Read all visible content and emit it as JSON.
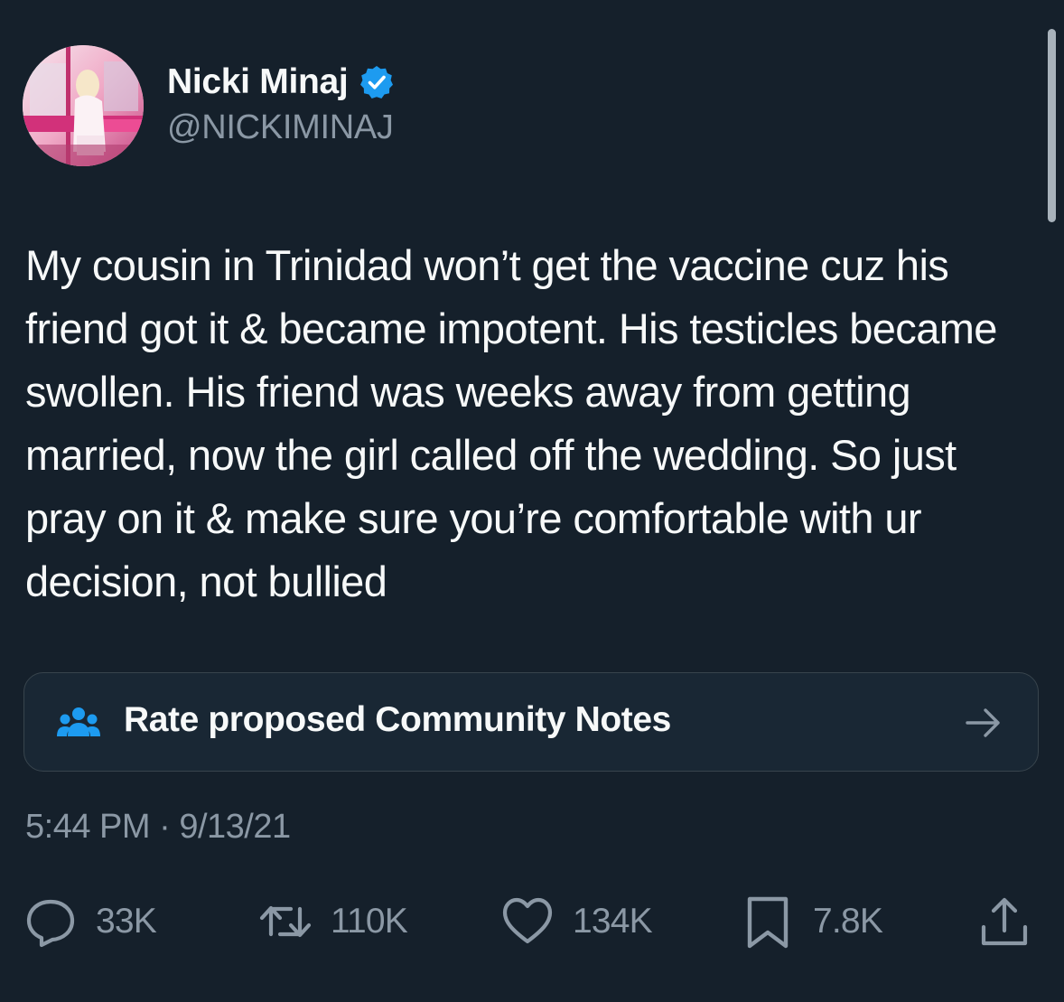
{
  "author": {
    "display_name": "Nicki Minaj",
    "handle": "@NICKIMINAJ",
    "verified_icon": "verified-badge-icon"
  },
  "tweet": {
    "text": "My cousin in Trinidad won’t get the vaccine cuz his friend got it & became impotent. His testicles became swollen. His friend was weeks away from getting married, now the girl called off the wedding. So just pray on it & make sure you’re comfortable with ur decision, not bullied",
    "time": "5:44 PM",
    "separator": "·",
    "date": "9/13/21"
  },
  "community_notes": {
    "label": "Rate proposed Community Notes",
    "icon": "community-people-icon",
    "arrow_icon": "arrow-right-icon"
  },
  "actions": {
    "replies": "33K",
    "retweets": "110K",
    "likes": "134K",
    "bookmarks": "7.8K"
  },
  "colors": {
    "background": "#15202b",
    "accent": "#1d9bf0",
    "secondary_text": "#8b98a5"
  }
}
